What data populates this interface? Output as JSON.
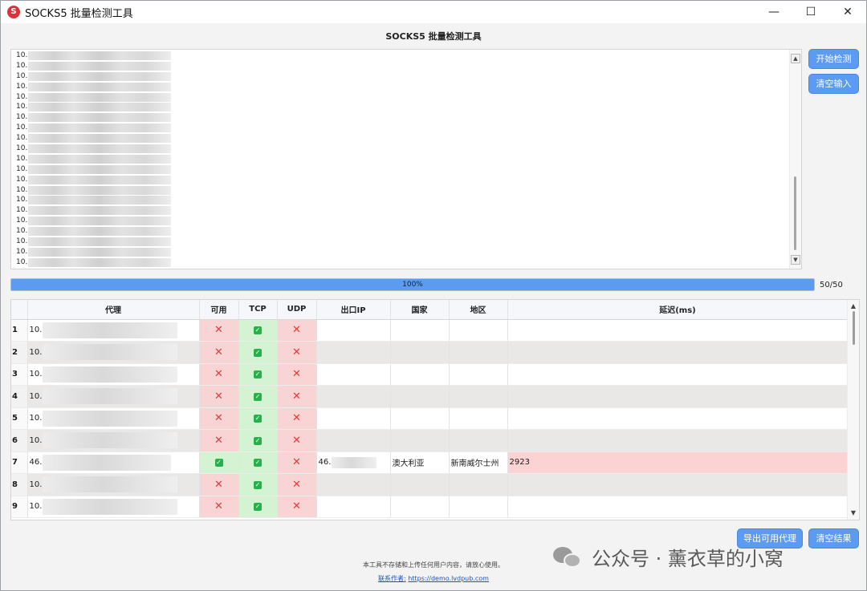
{
  "window": {
    "icon_label": "S",
    "title": "SOCKS5 批量检测工具",
    "controls": {
      "minimize": "—",
      "maximize": "☐",
      "close": "✕"
    }
  },
  "header": {
    "title": "SOCKS5 批量检测工具"
  },
  "input": {
    "line_prefix": "10.",
    "visible_line_count": 21
  },
  "actions": {
    "start_label": "开始检测",
    "clear_input_label": "清空输入",
    "export_label": "导出可用代理",
    "clear_results_label": "清空结果"
  },
  "progress": {
    "value": 100,
    "text": "100%",
    "count": "50/50"
  },
  "table": {
    "columns": [
      "",
      "代理",
      "可用",
      "TCP",
      "UDP",
      "出口IP",
      "国家",
      "地区",
      "延迟(ms)"
    ],
    "rows": [
      {
        "num": "1",
        "proxy": "10.",
        "available": false,
        "tcp": true,
        "udp": false,
        "exit_ip": "",
        "country": "",
        "region": "",
        "latency": ""
      },
      {
        "num": "2",
        "proxy": "10.",
        "available": false,
        "tcp": true,
        "udp": false,
        "exit_ip": "",
        "country": "",
        "region": "",
        "latency": ""
      },
      {
        "num": "3",
        "proxy": "10.",
        "available": false,
        "tcp": true,
        "udp": false,
        "exit_ip": "",
        "country": "",
        "region": "",
        "latency": ""
      },
      {
        "num": "4",
        "proxy": "10.",
        "available": false,
        "tcp": true,
        "udp": false,
        "exit_ip": "",
        "country": "",
        "region": "",
        "latency": ""
      },
      {
        "num": "5",
        "proxy": "10.",
        "available": false,
        "tcp": true,
        "udp": false,
        "exit_ip": "",
        "country": "",
        "region": "",
        "latency": ""
      },
      {
        "num": "6",
        "proxy": "10.",
        "available": false,
        "tcp": true,
        "udp": false,
        "exit_ip": "",
        "country": "",
        "region": "",
        "latency": ""
      },
      {
        "num": "7",
        "proxy": "46.",
        "available": true,
        "tcp": true,
        "udp": false,
        "exit_ip": "46.",
        "country": "澳大利亚",
        "region": "新南威尔士州",
        "latency": "2923"
      },
      {
        "num": "8",
        "proxy": "10.",
        "available": false,
        "tcp": true,
        "udp": false,
        "exit_ip": "",
        "country": "",
        "region": "",
        "latency": ""
      },
      {
        "num": "9",
        "proxy": "10.",
        "available": false,
        "tcp": true,
        "udp": false,
        "exit_ip": "",
        "country": "",
        "region": "",
        "latency": ""
      }
    ]
  },
  "footer": {
    "note": "本工具不存储和上传任何用户内容，请放心使用。",
    "contact_label": "联系作者:",
    "contact_url": "https://demo.lvdpub.com"
  },
  "watermark": {
    "text": "公众号 · 薰衣草的小窝"
  },
  "icons": {
    "fail": "✕",
    "pass": "✓",
    "scroll_up": "▲",
    "scroll_down": "▼"
  },
  "colors": {
    "accent": "#5b9bf2",
    "fail_bg": "#f9d4d4",
    "ok_bg": "#d3f3d3",
    "fail_mark": "#e03b3b",
    "ok_mark": "#27b04c"
  }
}
